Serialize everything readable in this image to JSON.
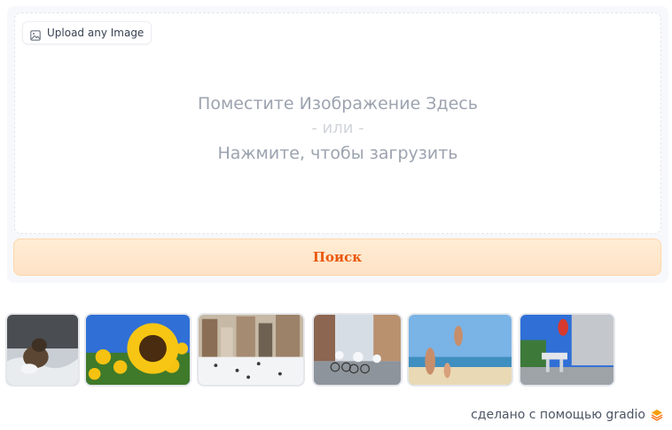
{
  "upload": {
    "badge_label": "Upload any Image",
    "drop_line1": "Поместите Изображение Здесь",
    "drop_line2": "- или -",
    "drop_line3": "Нажмите, чтобы загрузить"
  },
  "search_button": {
    "label": "Поиск"
  },
  "examples": [
    {
      "name": "dog-in-water"
    },
    {
      "name": "sunflower"
    },
    {
      "name": "ice-rink-city"
    },
    {
      "name": "cyclists-street"
    },
    {
      "name": "beach-frisbee"
    },
    {
      "name": "skateboard-jump"
    }
  ],
  "footer": {
    "text": "сделано с помощью gradio"
  },
  "colors": {
    "accent": "#ea580c",
    "button_bg": "#fee2c5",
    "border": "#e5e7eb"
  }
}
